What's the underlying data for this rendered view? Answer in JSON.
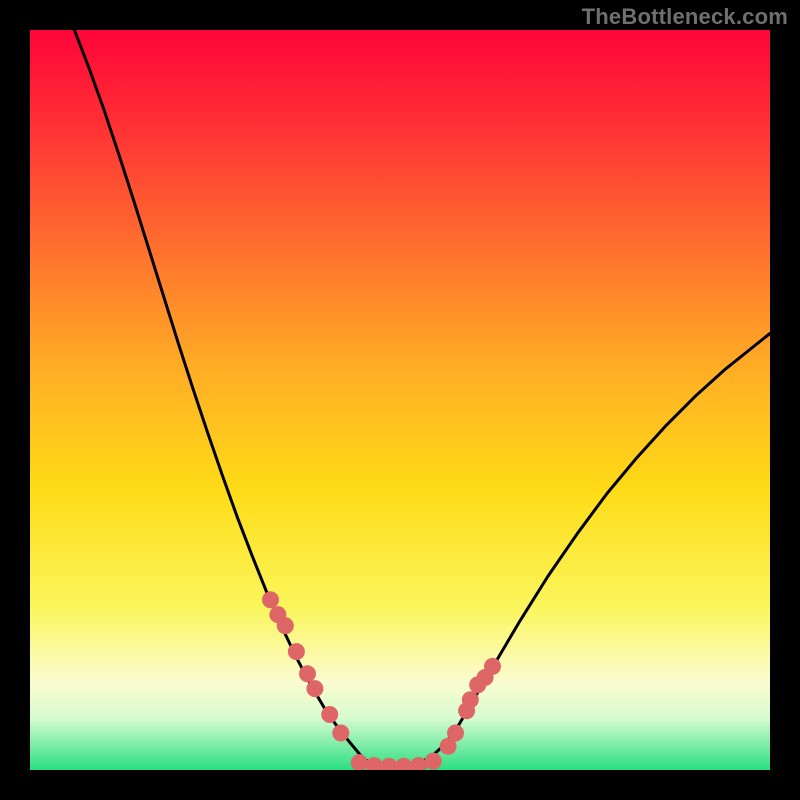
{
  "watermark": "TheBottleneck.com",
  "colors": {
    "black": "#000000",
    "curve": "#000000",
    "marker": "#df6666",
    "gradient_top": "#fe0539",
    "gradient_mid1": "#ff8f2a",
    "gradient_mid2": "#fee515",
    "gradient_mid3": "#fdfba9",
    "gradient_bottom": "#2bdf82"
  },
  "chart_data": {
    "type": "line",
    "title": "",
    "xlabel": "",
    "ylabel": "",
    "xlim": [
      0,
      100
    ],
    "ylim": [
      0,
      100
    ],
    "series": [
      {
        "name": "curve",
        "x": [
          6,
          8,
          10,
          12,
          14,
          16,
          18,
          20,
          22,
          24,
          26,
          28,
          30,
          32,
          34,
          36,
          38,
          40,
          42,
          44,
          45,
          46,
          48,
          50,
          52,
          54,
          56,
          58,
          60,
          62,
          64,
          66,
          70,
          74,
          78,
          82,
          86,
          90,
          94,
          98,
          100
        ],
        "y": [
          100,
          94.8,
          89.2,
          83.2,
          77,
          70.6,
          64.2,
          57.8,
          51.6,
          45.6,
          39.8,
          34.2,
          29,
          24,
          19.4,
          15.2,
          11.4,
          8,
          5.2,
          2.8,
          1.6,
          1,
          0.4,
          0.4,
          0.8,
          1.6,
          3.4,
          6.2,
          9.6,
          13,
          16.4,
          19.8,
          26.2,
          32,
          37.4,
          42.2,
          46.6,
          50.6,
          54.2,
          57.4,
          59
        ]
      }
    ],
    "markers": {
      "name": "highlighted-points",
      "x": [
        32.5,
        33.5,
        34.5,
        36,
        37.5,
        38.5,
        40.5,
        42,
        44.5,
        46.5,
        48.5,
        50.5,
        52.5,
        54.5,
        56.5,
        57.5,
        59,
        59.5,
        60.5,
        61.5,
        62.5
      ],
      "y": [
        23,
        21,
        19.5,
        16,
        13,
        11,
        7.5,
        5,
        1,
        0.6,
        0.5,
        0.5,
        0.6,
        1.2,
        3.2,
        5,
        8,
        9.5,
        11.5,
        12.5,
        14
      ]
    }
  }
}
